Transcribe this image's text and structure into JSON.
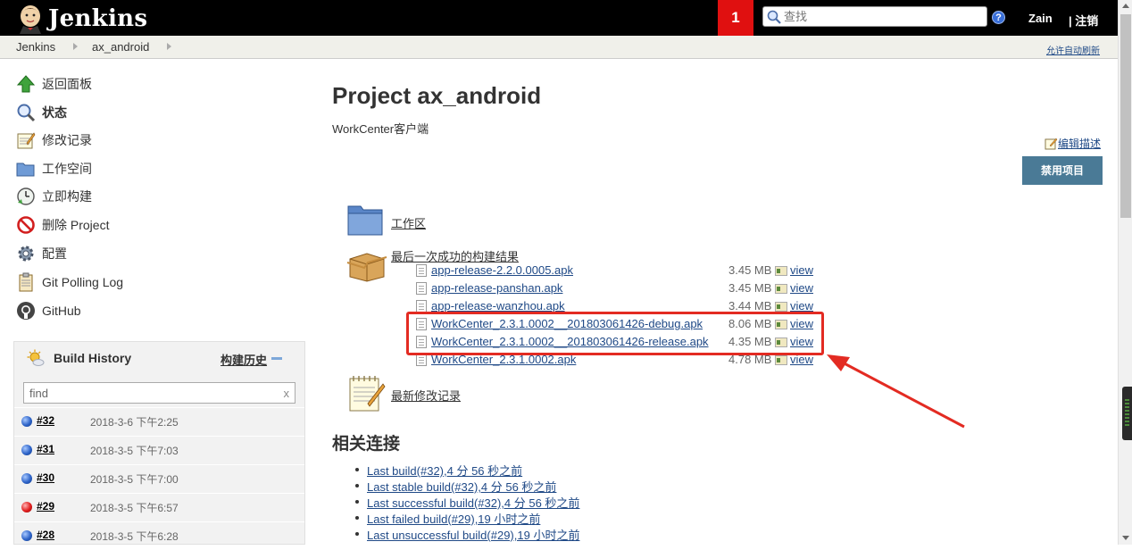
{
  "header": {
    "logo_text": "Jenkins",
    "notification_count": "1",
    "search_placeholder": "查找",
    "help_label": "?",
    "user": "Zain",
    "logout": "| 注销"
  },
  "breadcrumb": {
    "items": [
      "Jenkins",
      "ax_android"
    ],
    "auto_refresh": "允许自动刷新"
  },
  "sidebar": {
    "items": [
      {
        "label": "返回面板",
        "icon": "up-arrow-icon"
      },
      {
        "label": "状态",
        "icon": "magnifier-icon"
      },
      {
        "label": "修改记录",
        "icon": "notepad-icon"
      },
      {
        "label": "工作空间",
        "icon": "folder-icon"
      },
      {
        "label": "立即构建",
        "icon": "clock-icon"
      },
      {
        "label": "删除 Project",
        "icon": "no-entry-icon"
      },
      {
        "label": "配置",
        "icon": "gear-icon"
      },
      {
        "label": "Git Polling Log",
        "icon": "clipboard-icon"
      },
      {
        "label": "GitHub",
        "icon": "github-icon"
      }
    ]
  },
  "build_history": {
    "title": "Build History",
    "link": "构建历史",
    "find_placeholder": "find",
    "clear": "x",
    "builds": [
      {
        "num": "#32",
        "date": "2018-3-6 下午2:25",
        "status": "blue"
      },
      {
        "num": "#31",
        "date": "2018-3-5 下午7:03",
        "status": "blue"
      },
      {
        "num": "#30",
        "date": "2018-3-5 下午7:00",
        "status": "blue"
      },
      {
        "num": "#29",
        "date": "2018-3-5 下午6:57",
        "status": "red"
      },
      {
        "num": "#28",
        "date": "2018-3-5 下午6:28",
        "status": "blue"
      }
    ]
  },
  "main": {
    "title": "Project ax_android",
    "description": "WorkCenter客户端",
    "edit_description": "编辑描述",
    "disable_button": "禁用项目",
    "workspace_link": "工作区",
    "last_artifacts_link": "最后一次成功的构建结果",
    "artifacts": [
      {
        "name": "app-release-2.2.0.0005.apk",
        "size": "3.45 MB",
        "view": "view"
      },
      {
        "name": "app-release-panshan.apk",
        "size": "3.45 MB",
        "view": "view"
      },
      {
        "name": "app-release-wanzhou.apk",
        "size": "3.44 MB",
        "view": "view"
      },
      {
        "name": "WorkCenter_2.3.1.0002__201803061426-debug.apk",
        "size": "8.06 MB",
        "view": "view"
      },
      {
        "name": "WorkCenter_2.3.1.0002__201803061426-release.apk",
        "size": "4.35 MB",
        "view": "view"
      },
      {
        "name": "WorkCenter_2.3.1.0002.apk",
        "size": "4.78 MB",
        "view": "view"
      }
    ],
    "recent_changes_link": "最新修改记录",
    "related_title": "相关连接",
    "related_links": [
      "Last build(#32),4 分 56 秒之前",
      "Last stable build(#32),4 分 56 秒之前",
      "Last successful build(#32),4 分 56 秒之前",
      "Last failed build(#29),19 小时之前",
      "Last unsuccessful build(#29),19 小时之前"
    ]
  },
  "colors": {
    "header_bg": "#000000",
    "notification_bg": "#e01010",
    "link": "#204a87",
    "annotation_red": "#e32b22",
    "disable_button_bg": "#4a7a96"
  }
}
